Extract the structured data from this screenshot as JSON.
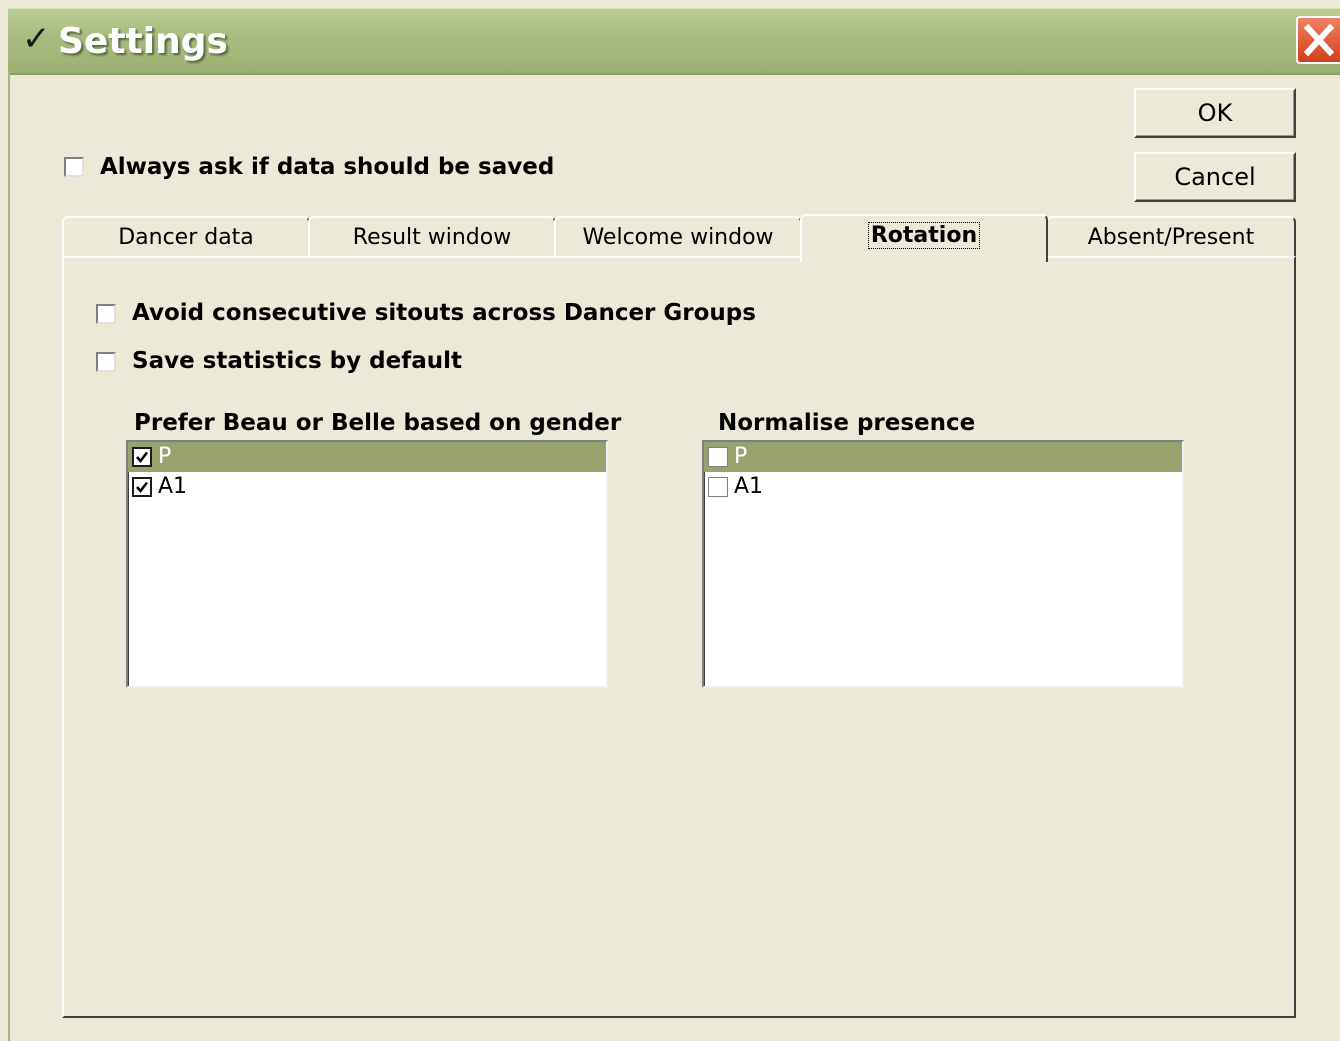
{
  "window": {
    "title": "Settings",
    "title_icon": "checkmark-icon",
    "close_icon": "close-icon"
  },
  "buttons": {
    "ok": "OK",
    "cancel": "Cancel"
  },
  "always_ask": {
    "label": "Always ask if data should be saved",
    "checked": false
  },
  "tabs": [
    {
      "label": "Dancer data",
      "active": false
    },
    {
      "label": "Result window",
      "active": false
    },
    {
      "label": "Welcome window",
      "active": false
    },
    {
      "label": "Rotation",
      "active": true
    },
    {
      "label": "Absent/Present",
      "active": false
    }
  ],
  "rotation": {
    "avoid_sitouts": {
      "label": "Avoid consecutive sitouts across Dancer Groups",
      "checked": false
    },
    "save_stats": {
      "label": "Save statistics by default",
      "checked": false
    },
    "prefer_list": {
      "heading": "Prefer Beau or Belle based on gender",
      "items": [
        {
          "label": "P",
          "checked": true,
          "selected": true
        },
        {
          "label": "A1",
          "checked": true,
          "selected": false
        }
      ]
    },
    "normalise_list": {
      "heading": "Normalise presence",
      "items": [
        {
          "label": "P",
          "checked": false,
          "selected": true
        },
        {
          "label": "A1",
          "checked": false,
          "selected": false
        }
      ]
    }
  },
  "colors": {
    "titlebar": "#a9bd80",
    "selection": "#98a26e",
    "close": "#d2401c",
    "face": "#ece9d8"
  }
}
